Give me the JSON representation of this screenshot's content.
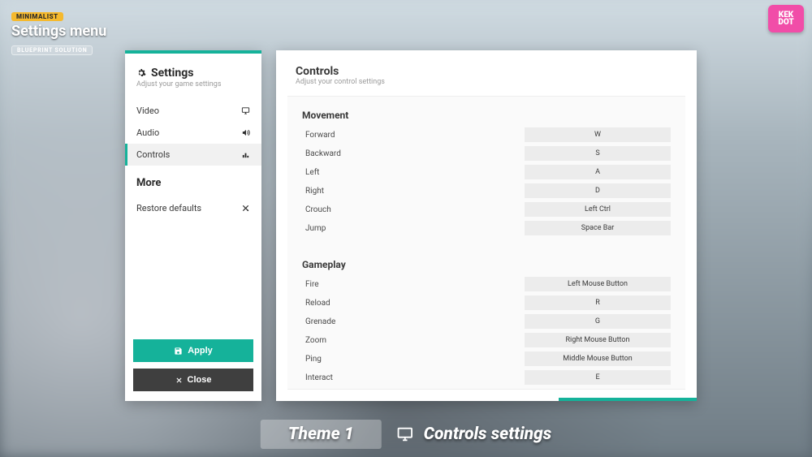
{
  "topleft": {
    "badge_top": "MINIMALIST",
    "title": "Settings menu",
    "badge_bottom": "BLUEPRINT SOLUTION"
  },
  "logo": {
    "line1": "KEK",
    "line2": "DOT"
  },
  "sidebar": {
    "title": "Settings",
    "subtitle": "Adjust your game settings",
    "items": [
      {
        "label": "Video",
        "icon": "monitor"
      },
      {
        "label": "Audio",
        "icon": "speaker"
      },
      {
        "label": "Controls",
        "icon": "equalizer"
      }
    ],
    "more_title": "More",
    "more_items": [
      {
        "label": "Restore defaults",
        "icon": "reset"
      }
    ],
    "apply": "Apply",
    "close": "Close"
  },
  "main": {
    "title": "Controls",
    "subtitle": "Adjust your control settings",
    "sections": [
      {
        "title": "Movement",
        "rows": [
          {
            "label": "Forward",
            "value": "W"
          },
          {
            "label": "Backward",
            "value": "S"
          },
          {
            "label": "Left",
            "value": "A"
          },
          {
            "label": "Right",
            "value": "D"
          },
          {
            "label": "Crouch",
            "value": "Left Ctrl"
          },
          {
            "label": "Jump",
            "value": "Space Bar"
          }
        ]
      },
      {
        "title": "Gameplay",
        "rows": [
          {
            "label": "Fire",
            "value": "Left Mouse Button"
          },
          {
            "label": "Reload",
            "value": "R"
          },
          {
            "label": "Grenade",
            "value": "G"
          },
          {
            "label": "Zoom",
            "value": "Right Mouse Button"
          },
          {
            "label": "Ping",
            "value": "Middle Mouse Button"
          },
          {
            "label": "Interact",
            "value": "E"
          }
        ]
      }
    ]
  },
  "banner": {
    "left": "Theme 1",
    "right": "Controls settings"
  },
  "colors": {
    "accent": "#15b29a"
  }
}
